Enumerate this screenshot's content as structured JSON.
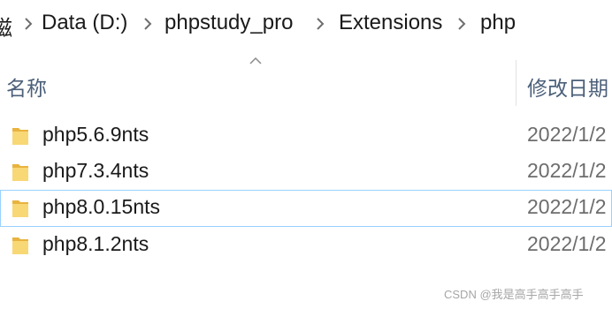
{
  "breadcrumb": {
    "items": [
      "磁",
      "Data (D:)",
      "phpstudy_pro",
      "Extensions",
      "php"
    ]
  },
  "columns": {
    "name": "名称",
    "date_modified": "修改日期"
  },
  "files": [
    {
      "name": "php5.6.9nts",
      "date": "2022/1/2",
      "selected": false
    },
    {
      "name": "php7.3.4nts",
      "date": "2022/1/2",
      "selected": false
    },
    {
      "name": "php8.0.15nts",
      "date": "2022/1/2",
      "selected": true
    },
    {
      "name": "php8.1.2nts",
      "date": "2022/1/2",
      "selected": false
    }
  ],
  "watermark": "CSDN @我是高手高手高手",
  "colors": {
    "folder": "#f8d775",
    "folder_dark": "#e8b33e",
    "selection_border": "#99d1ff",
    "header_text": "#4c607a"
  },
  "icons": {
    "chevron": "chevron-right-icon",
    "sort": "sort-up-icon",
    "folder": "folder-icon"
  }
}
